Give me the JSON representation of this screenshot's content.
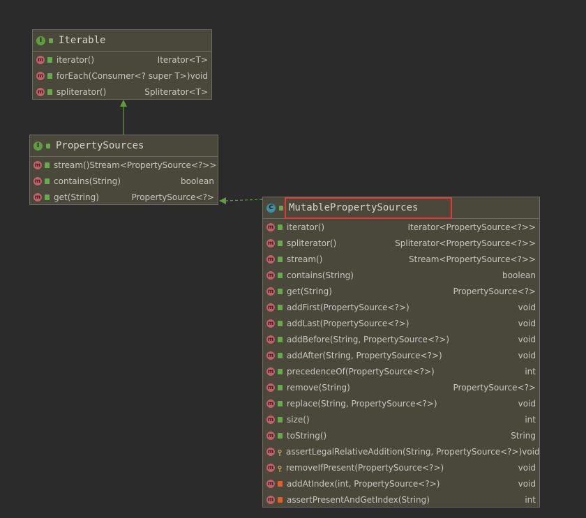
{
  "classes": {
    "iterable": {
      "kind_letter": "I",
      "title": "Iterable",
      "methods": [
        {
          "name": "iterator()",
          "type": "Iterator<T>",
          "visibility": "public"
        },
        {
          "name": "forEach(Consumer<? super T>)",
          "type": "void",
          "visibility": "public"
        },
        {
          "name": "spliterator()",
          "type": "Spliterator<T>",
          "visibility": "public"
        }
      ]
    },
    "property_sources": {
      "kind_letter": "I",
      "title": "PropertySources",
      "methods": [
        {
          "name": "stream()",
          "type": "Stream<PropertySource<?>>",
          "visibility": "public"
        },
        {
          "name": "contains(String)",
          "type": "boolean",
          "visibility": "public"
        },
        {
          "name": "get(String)",
          "type": "PropertySource<?>",
          "visibility": "public"
        }
      ]
    },
    "mutable_property_sources": {
      "kind_letter": "C",
      "title": "MutablePropertySources",
      "methods": [
        {
          "name": "iterator()",
          "type": "Iterator<PropertySource<?>>",
          "visibility": "public"
        },
        {
          "name": "spliterator()",
          "type": "Spliterator<PropertySource<?>>",
          "visibility": "public"
        },
        {
          "name": "stream()",
          "type": "Stream<PropertySource<?>>",
          "visibility": "public"
        },
        {
          "name": "contains(String)",
          "type": "boolean",
          "visibility": "public"
        },
        {
          "name": "get(String)",
          "type": "PropertySource<?>",
          "visibility": "public"
        },
        {
          "name": "addFirst(PropertySource<?>)",
          "type": "void",
          "visibility": "public"
        },
        {
          "name": "addLast(PropertySource<?>)",
          "type": "void",
          "visibility": "public"
        },
        {
          "name": "addBefore(String, PropertySource<?>)",
          "type": "void",
          "visibility": "public"
        },
        {
          "name": "addAfter(String, PropertySource<?>)",
          "type": "void",
          "visibility": "public"
        },
        {
          "name": "precedenceOf(PropertySource<?>)",
          "type": "int",
          "visibility": "public"
        },
        {
          "name": "remove(String)",
          "type": "PropertySource<?>",
          "visibility": "public"
        },
        {
          "name": "replace(String, PropertySource<?>)",
          "type": "void",
          "visibility": "public"
        },
        {
          "name": "size()",
          "type": "int",
          "visibility": "public"
        },
        {
          "name": "toString()",
          "type": "String",
          "visibility": "public"
        },
        {
          "name": "assertLegalRelativeAddition(String, PropertySource<?>)",
          "type": "void",
          "visibility": "protected"
        },
        {
          "name": "removeIfPresent(PropertySource<?>)",
          "type": "void",
          "visibility": "protected"
        },
        {
          "name": "addAtIndex(int, PropertySource<?>)",
          "type": "void",
          "visibility": "private"
        },
        {
          "name": "assertPresentAndGetIndex(String)",
          "type": "int",
          "visibility": "private"
        }
      ]
    }
  },
  "method_badge_letter": "m",
  "colors": {
    "background": "#2b2b2b",
    "box_fill": "#4a473b",
    "edge": "#5f9e3a",
    "highlight": "#e53935"
  }
}
